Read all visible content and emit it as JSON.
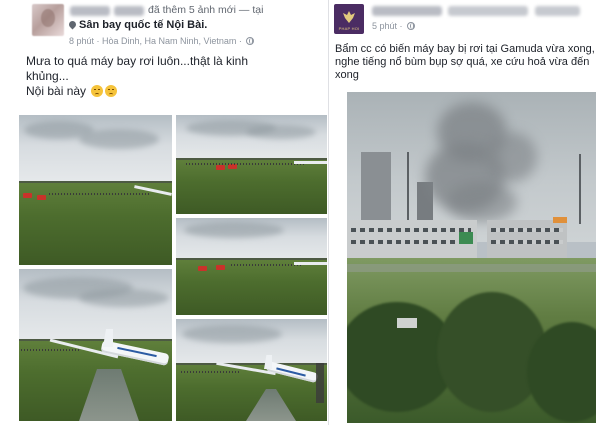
{
  "left_post": {
    "action_text": "đã thêm 5 ảnh mới — tại",
    "place": "Sân bay quốc tế Nội Bài.",
    "meta": "8 phút · Hòa Dinh, Ha Nam Ninh, Vietnam ·",
    "text_line1": "Mưa to quá máy bay rơi luôn...thật là kinh",
    "text_line2": "khủng...",
    "text_line3": "Nội bài này",
    "photos": [
      "photo-1",
      "photo-2",
      "photo-3",
      "photo-4",
      "photo-5"
    ]
  },
  "right_post": {
    "page_logo_text": "PHAP HOI",
    "meta": "5 phút ·",
    "text_line1": "Bẩm cc có biến máy bay bị rơi tại Gamuda vừa xong,",
    "text_line2": "nghe tiếng nổ bùm bụp sợ quá, xe cứu hoả vừa đến",
    "text_line3": "xong"
  },
  "icons": {
    "location": "map-pin-icon",
    "privacy": "globe-icon",
    "emoji": "sad-face-emoji-icon"
  },
  "colors": {
    "page_avatar_bg": "#4b2c63",
    "meta_text": "#8d949e",
    "primary_text": "#1d2129"
  }
}
